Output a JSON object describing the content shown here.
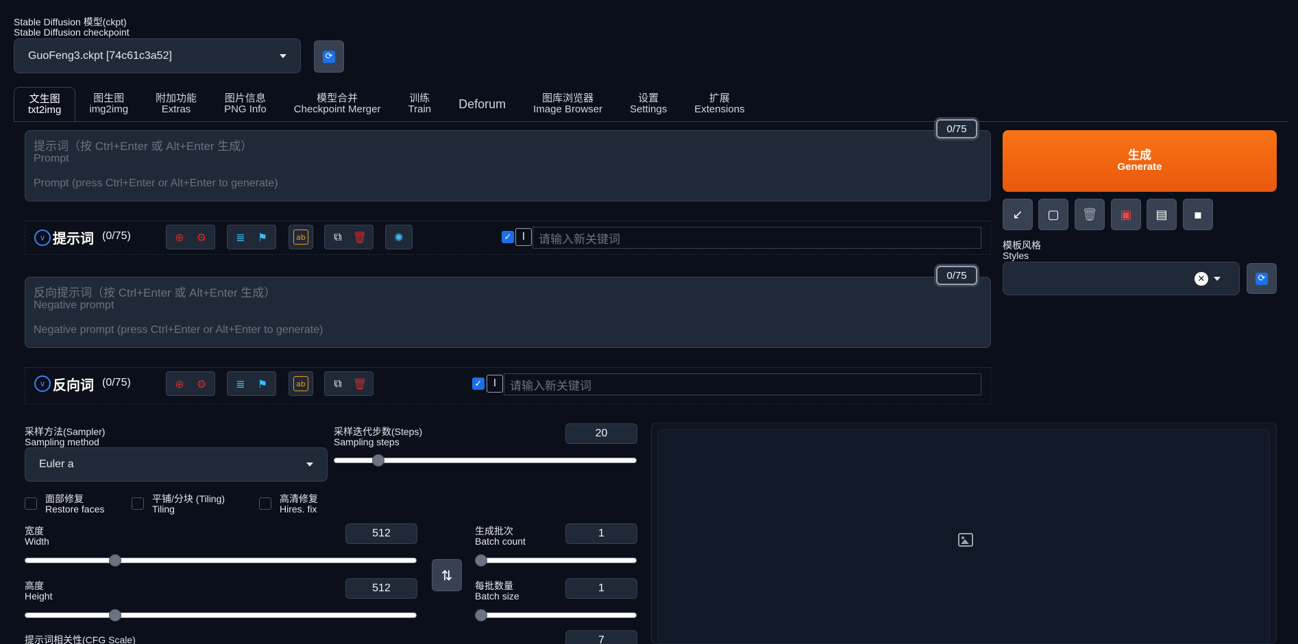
{
  "checkpoint": {
    "label_zh": "Stable Diffusion 模型(ckpt)",
    "label_en": "Stable Diffusion checkpoint",
    "selected": "GuoFeng3.ckpt [74c61c3a52]",
    "refresh_icon": "refresh-icon"
  },
  "tabs": [
    {
      "zh": "文生图",
      "en": "txt2img"
    },
    {
      "zh": "图生图",
      "en": "img2img"
    },
    {
      "zh": "附加功能",
      "en": "Extras"
    },
    {
      "zh": "图片信息",
      "en": "PNG Info"
    },
    {
      "zh": "模型合并",
      "en": "Checkpoint Merger"
    },
    {
      "zh": "训练",
      "en": "Train"
    },
    {
      "single": "Deforum"
    },
    {
      "zh": "图库浏览器",
      "en": "Image Browser"
    },
    {
      "zh": "设置",
      "en": "Settings"
    },
    {
      "zh": "扩展",
      "en": "Extensions"
    }
  ],
  "prompt": {
    "counter": "0/75",
    "label_zh": "提示词（按 Ctrl+Enter 或 Alt+Enter 生成）",
    "label_en": "Prompt",
    "placeholder": "Prompt (press Ctrl+Enter or Alt+Enter to generate)"
  },
  "prompt_tags": {
    "title": "提示词",
    "count": "(0/75)",
    "keyword_placeholder": "请输入新关键词"
  },
  "negative": {
    "counter": "0/75",
    "label_zh": "反向提示词（按 Ctrl+Enter 或 Alt+Enter 生成）",
    "label_en": "Negative prompt",
    "placeholder": "Negative prompt (press Ctrl+Enter or Alt+Enter to generate)"
  },
  "negative_tags": {
    "title": "反向词",
    "count": "(0/75)",
    "keyword_placeholder": "请输入新关键词"
  },
  "generate": {
    "zh": "生成",
    "en": "Generate"
  },
  "styles": {
    "zh": "模板风格",
    "en": "Styles"
  },
  "sampler": {
    "zh": "采样方法(Sampler)",
    "en": "Sampling method",
    "selected": "Euler a"
  },
  "steps": {
    "zh": "采样迭代步数(Steps)",
    "en": "Sampling steps",
    "value": "20",
    "fraction": 0.133
  },
  "checkboxes": [
    {
      "zh": "面部修复",
      "en": "Restore faces"
    },
    {
      "zh": "平铺/分块 (Tiling)",
      "en": "Tiling"
    },
    {
      "zh": "高清修复",
      "en": "Hires. fix"
    }
  ],
  "width": {
    "zh": "宽度",
    "en": "Width",
    "value": "512",
    "fraction": 0.222
  },
  "height": {
    "zh": "高度",
    "en": "Height",
    "value": "512",
    "fraction": 0.222
  },
  "batch_count": {
    "zh": "生成批次",
    "en": "Batch count",
    "value": "1",
    "fraction": 0
  },
  "batch_size": {
    "zh": "每批数量",
    "en": "Batch size",
    "value": "1",
    "fraction": 0
  },
  "cfg": {
    "zh": "提示词相关性(CFG Scale)",
    "value": "7"
  },
  "colors": {
    "accent": "#f97316",
    "background": "#0b0f19",
    "checkbox": "#1d6fe8"
  }
}
